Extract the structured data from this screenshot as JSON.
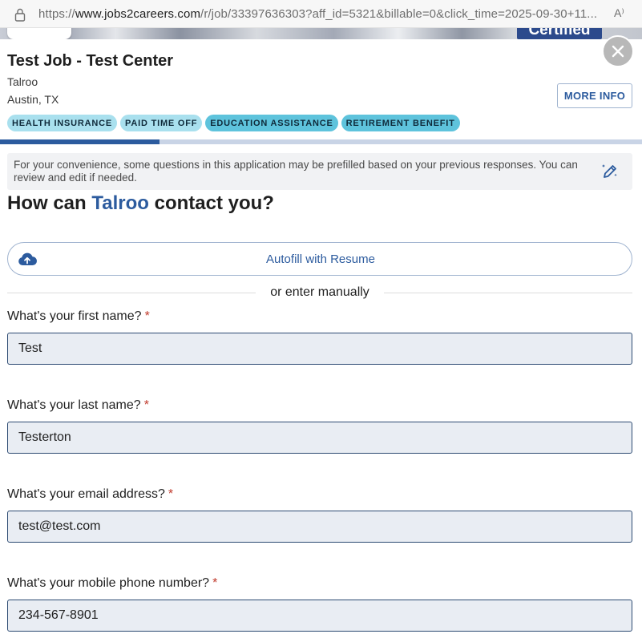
{
  "browser": {
    "url_prefix": "https://",
    "url_host": "www.jobs2careers.com",
    "url_rest": "/r/job/33397636303?aff_id=5321&billable=0&click_time=2025-09-30+11...",
    "reader_label": "A⁾"
  },
  "banner": {
    "certified_label": "Certified"
  },
  "job": {
    "title": "Test Job - Test Center",
    "company": "Talroo",
    "location": "Austin, TX",
    "more_info_label": "MORE INFO",
    "tags": [
      "HEALTH INSURANCE",
      "PAID TIME OFF",
      "EDUCATION ASSISTANCE",
      "RETIREMENT BENEFIT"
    ]
  },
  "progress": {
    "fraction": 0.248
  },
  "notice": {
    "text": "For your convenience, some questions in this application may be prefilled based on your previous responses. You can review and edit if needed."
  },
  "heading": {
    "prefix": "How can ",
    "company": "Talroo",
    "suffix": " contact you?"
  },
  "autofill": {
    "label": "Autofill with Resume"
  },
  "divider_text": "or enter manually",
  "fields": {
    "first_name": {
      "label": "What's your first name?",
      "required_mark": "*",
      "value": "Test"
    },
    "last_name": {
      "label": "What's your last name?",
      "required_mark": "*",
      "value": "Testerton"
    },
    "email": {
      "label": "What's your email address?",
      "required_mark": "*",
      "value": "test@test.com"
    },
    "phone": {
      "label": "What's your mobile phone number?",
      "required_mark": "*",
      "value": "234-567-8901"
    }
  },
  "colors": {
    "brand_blue": "#2c5b9e",
    "tag_dark": "#5ec3dc",
    "tag_light": "#a9e0ee",
    "required_red": "#c0392b"
  }
}
